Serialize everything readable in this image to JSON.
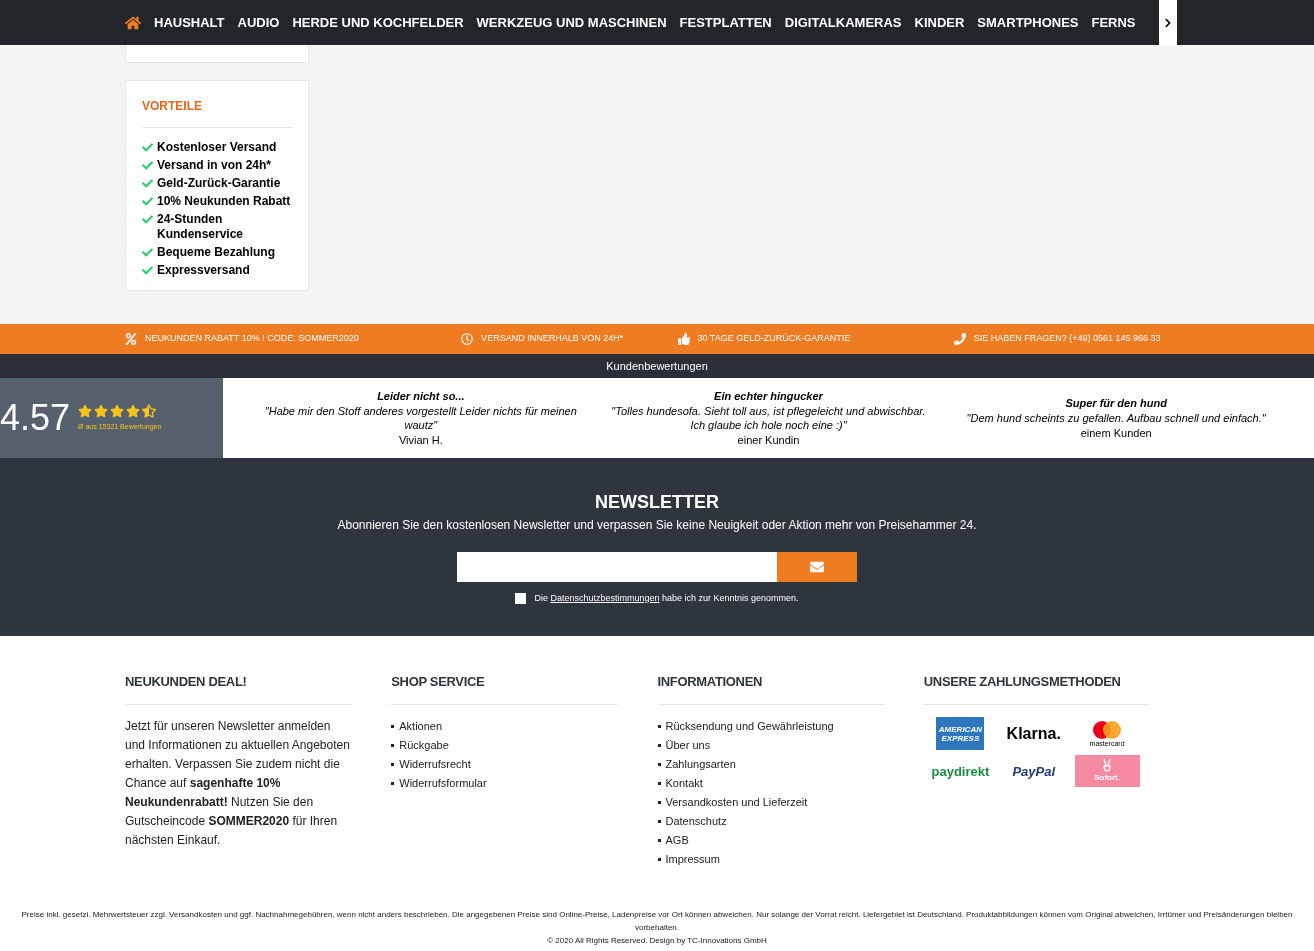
{
  "nav": {
    "items": [
      {
        "label": "HAUSHALT"
      },
      {
        "label": "AUDIO"
      },
      {
        "label": "HERDE UND KOCHFELDER"
      },
      {
        "label": "WERKZEUG UND MASCHINEN"
      },
      {
        "label": "FESTPLATTEN"
      },
      {
        "label": "DIGITALKAMERAS"
      },
      {
        "label": "KINDER"
      },
      {
        "label": "SMARTPHONES"
      },
      {
        "label": "FERNS"
      }
    ]
  },
  "benefits": {
    "title": "VORTEILE",
    "items": [
      "Kostenloser Versand",
      "Versand in von 24h*",
      "Geld-Zurück-Garantie",
      "10% Neukunden Rabatt",
      "24-Stunden Kundenservice",
      "Bequeme Bezahlung",
      "Expressversand"
    ]
  },
  "promo_bar": [
    {
      "kind": "percent",
      "text": "NEUKUNDEN RABATT 10% ! CODE: SOMMER2020"
    },
    {
      "kind": "clock",
      "text": "VERSAND INNERHALB VON 24H*"
    },
    {
      "kind": "thumb",
      "text": "30 TAGE GELD-ZURÜCK-GARANTIE"
    },
    {
      "kind": "phone",
      "text": "SIE HABEN FRAGEN? (+49) 0561 145 966 33"
    }
  ],
  "reviews": {
    "title": "Kundenbewertungen",
    "score": "4.57",
    "stars": 4.5,
    "count": "Ø aus 15321 Bewertungen",
    "items": [
      {
        "title": "Leider nicht so...",
        "text": "\"Habe mir den Stoff anderes vorgestellt Leider nichts für meinen wautz\"",
        "author": "Vivian H."
      },
      {
        "title": "Ein echter hingucker",
        "text": "\"Tolles hundesofa. Sieht toll aus, ist pflegeleicht und abwischbar. Ich glaube ich hole noch eine :)\"",
        "author": "einer Kundin"
      },
      {
        "title": "Super für den hund",
        "text": "\"Dem hund scheints zu gefallen. Aufbau schnell und einfach.\"",
        "author": "einem Kunden"
      }
    ]
  },
  "newsletter": {
    "title": "NEWSLETTER",
    "text": "Abonnieren Sie den kostenlosen Newsletter und verpassen Sie keine Neuigkeit oder Aktion mehr von Preisehammer 24.",
    "consent_before": "Die",
    "consent_link": "Datenschutzbestimmungen",
    "consent_after": "habe ich zur Kenntnis genommen.",
    "checked": false
  },
  "footer": {
    "deal": {
      "title": "NEUKUNDEN DEAL!",
      "text": "Jetzt für unseren Newsletter anmelden und Informationen zu aktuellen Angeboten erhalten. Verpassen Sie zudem nicht die Chance auf **sagenhafte 10% Neukundenrabatt!** Nutzen Sie den Gutscheincode **SOMMER2020** für Ihren nächsten Einkauf."
    },
    "shop_service": {
      "title": "SHOP SERVICE",
      "links": [
        "Aktionen",
        "Rückgabe",
        "Widerrufsrecht",
        "Widerrufsformular"
      ]
    },
    "informationen": {
      "title": "INFORMATIONEN",
      "links": [
        "Rücksendung und Gewährleistung",
        "Über uns",
        "Zahlungsarten",
        "Kontakt",
        "Versandkosten und Lieferzeit",
        "Datenschutz",
        "AGB",
        "Impressum"
      ]
    },
    "payment": {
      "title": "UNSERE ZAHLUNGSMETHODEN",
      "methods": [
        {
          "kind": "amex",
          "label": "AMERICAN EXPRESS"
        },
        {
          "kind": "klarna",
          "label": "Klarna."
        },
        {
          "kind": "mastercard",
          "label": "mastercard"
        },
        {
          "kind": "paydirekt",
          "label": "paydirekt"
        },
        {
          "kind": "paypal",
          "label": "PayPal"
        },
        {
          "kind": "sofort",
          "label": "Sofort."
        }
      ]
    }
  },
  "legal": {
    "text": "Preise inkl. gesetzl. Mehrwertsteuer zzgl. Versandkosten und ggf. Nachnahmegebühren, wenn nicht anders beschrieben. Die angegebenen Preise sind Online-Preise, Ladenpreise vor Ort können abweichen. Nur solange der Vorrat reicht. Liefergebiet ist Deutschland. Produktabbildungen können vom Original abweichen, Irrtümer und Preisänderungen bleiben vorbehalten.",
    "copyright": "© 2020 All Rights Reserved. Design by TC-Innovations GmbH"
  }
}
